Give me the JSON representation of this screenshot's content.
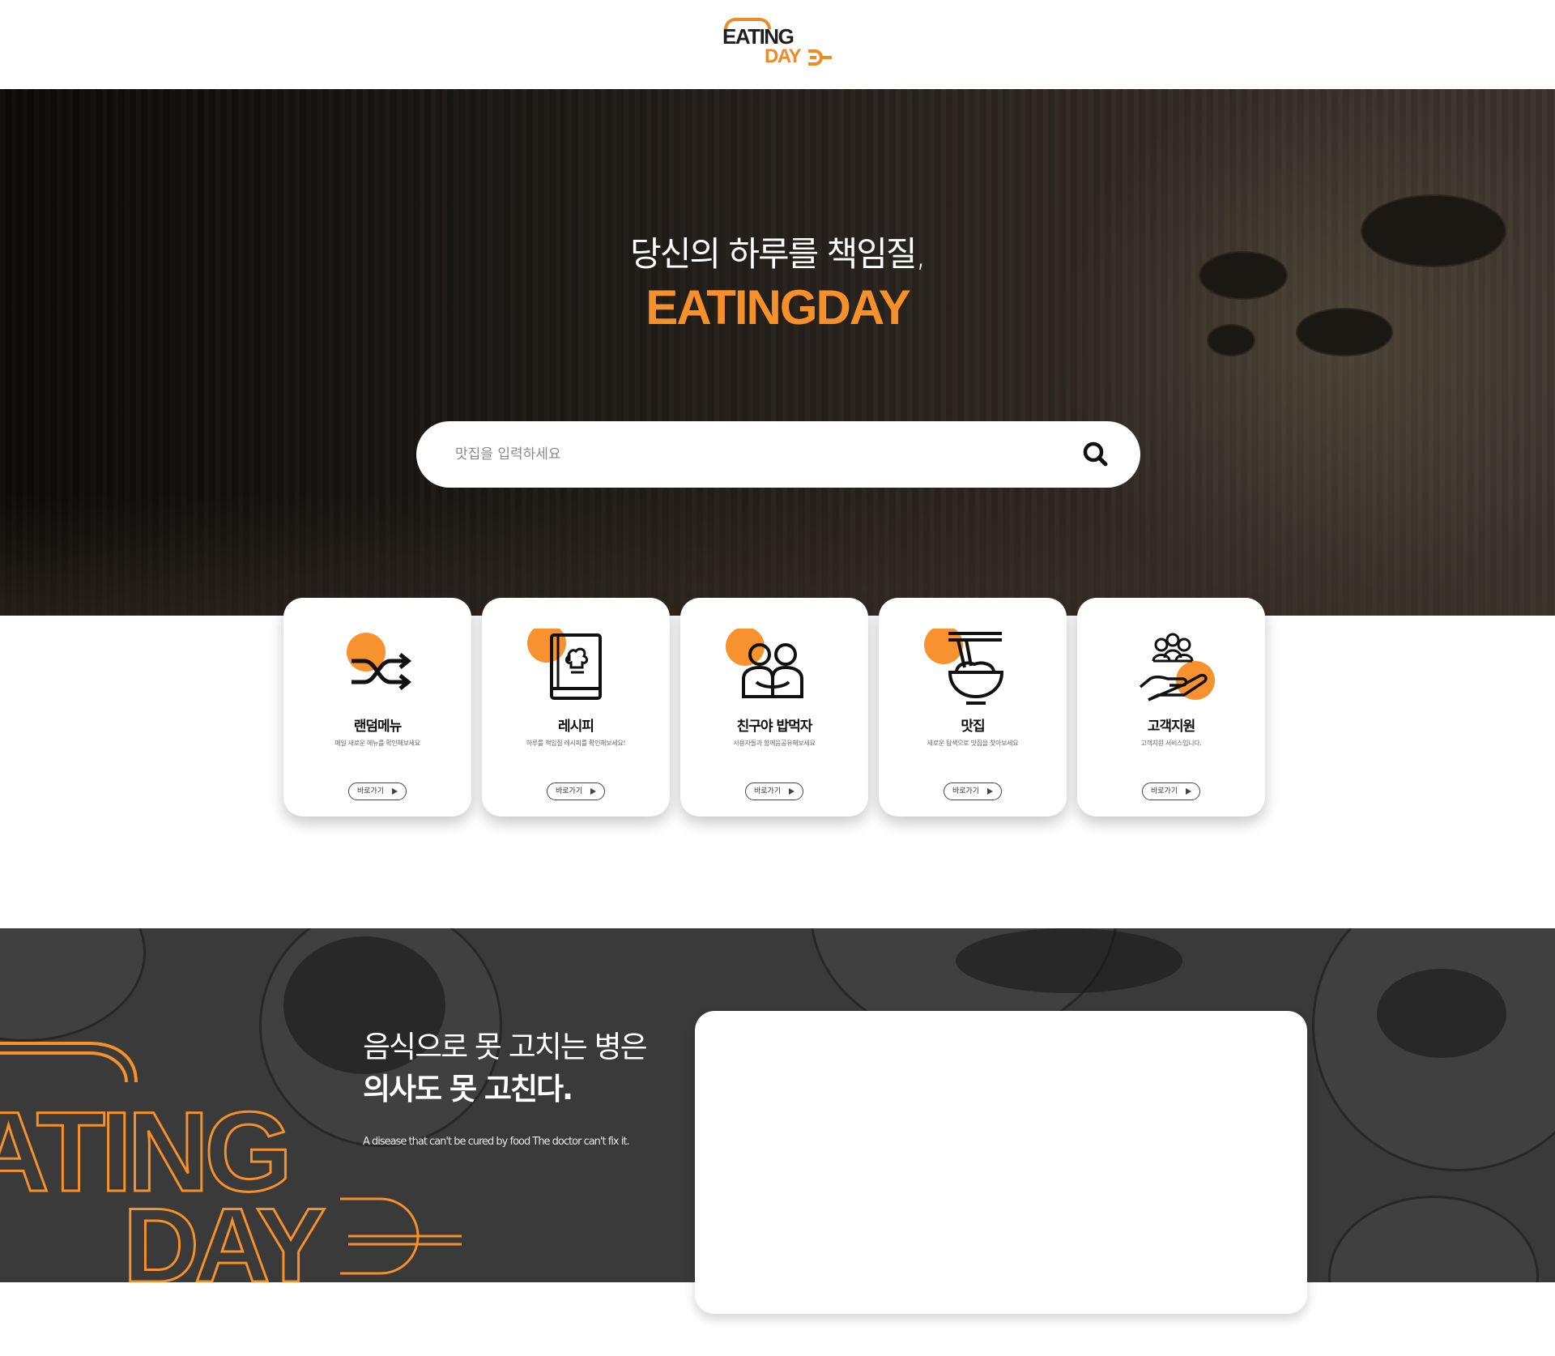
{
  "header": {
    "logo_line1": "EATING",
    "logo_line2": "DAY"
  },
  "hero": {
    "subtitle": "당신의 하루를 책임질,",
    "title": "EATINGDAY",
    "search_placeholder": "맛집을 입력하세요"
  },
  "cards": [
    {
      "title": "랜덤메뉴",
      "desc": "매일 새로운 메뉴를 확인해보세요",
      "button": "바로가기",
      "icon": "shuffle-icon"
    },
    {
      "title": "레시피",
      "desc": "하루를 책임질 레시피를 확인해보세요!",
      "button": "바로가기",
      "icon": "recipe-book-icon"
    },
    {
      "title": "친구야 밥먹자",
      "desc": "사용자들과 함께음공유해보세요",
      "button": "바로가기",
      "icon": "friends-icon"
    },
    {
      "title": "맛집",
      "desc": "새로운 탐색으로 맛집을 찾아보세요",
      "button": "바로가기",
      "icon": "noodle-bowl-icon"
    },
    {
      "title": "고객지원",
      "desc": "고객지원 서비스입니다.",
      "button": "바로가기",
      "icon": "customer-support-icon"
    }
  ],
  "promo": {
    "line1": "음식으로 못 고치는 병은",
    "line2": "의사도 못 고친다.",
    "english": "A disease that can't be cured by food  The doctor can't fix it.",
    "watermark_line1": "ATING",
    "watermark_line2": "DAY"
  },
  "colors": {
    "accent": "#f5902a",
    "dark": "#1e1e1e"
  }
}
